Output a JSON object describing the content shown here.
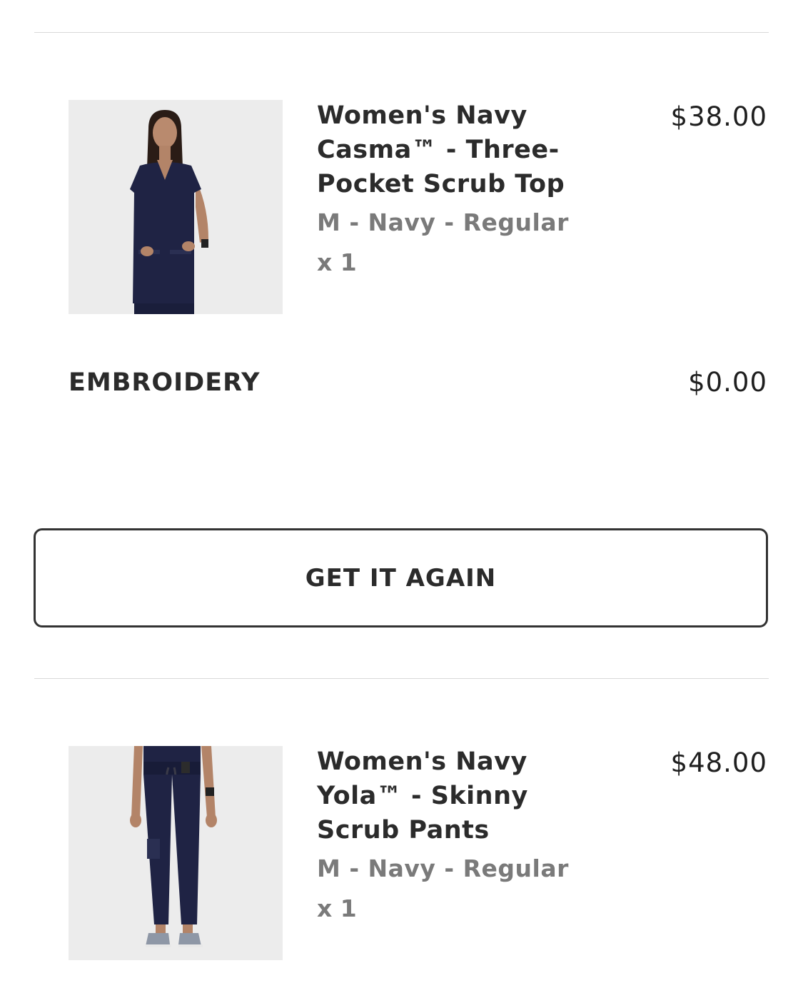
{
  "order_items": [
    {
      "name": "Women's Navy Casma™ - Three-Pocket Scrub Top",
      "name_lines": [
        "Women's Navy",
        "Casma™ - Three-",
        "Pocket Scrub Top"
      ],
      "variant": "M - Navy - Regular",
      "quantity": "x 1",
      "price": "$38.00",
      "image_icon": "scrub-top-photo"
    },
    {
      "name": "Women's Navy Yola™ - Skinny Scrub Pants",
      "name_lines": [
        "Women's Navy",
        "Yola™ - Skinny",
        "Scrub Pants"
      ],
      "variant": "M - Navy - Regular",
      "quantity": "x 1",
      "price": "$48.00",
      "image_icon": "scrub-pants-photo"
    }
  ],
  "addon": {
    "label": "EMBROIDERY",
    "price": "$0.00"
  },
  "actions": {
    "get_it_again_label": "GET IT AGAIN"
  },
  "colors": {
    "navy": "#1f2344",
    "text": "#2b2b2b",
    "muted": "#7a7a7a",
    "divider": "#d9d9d9",
    "photo_bg": "#ececec"
  }
}
